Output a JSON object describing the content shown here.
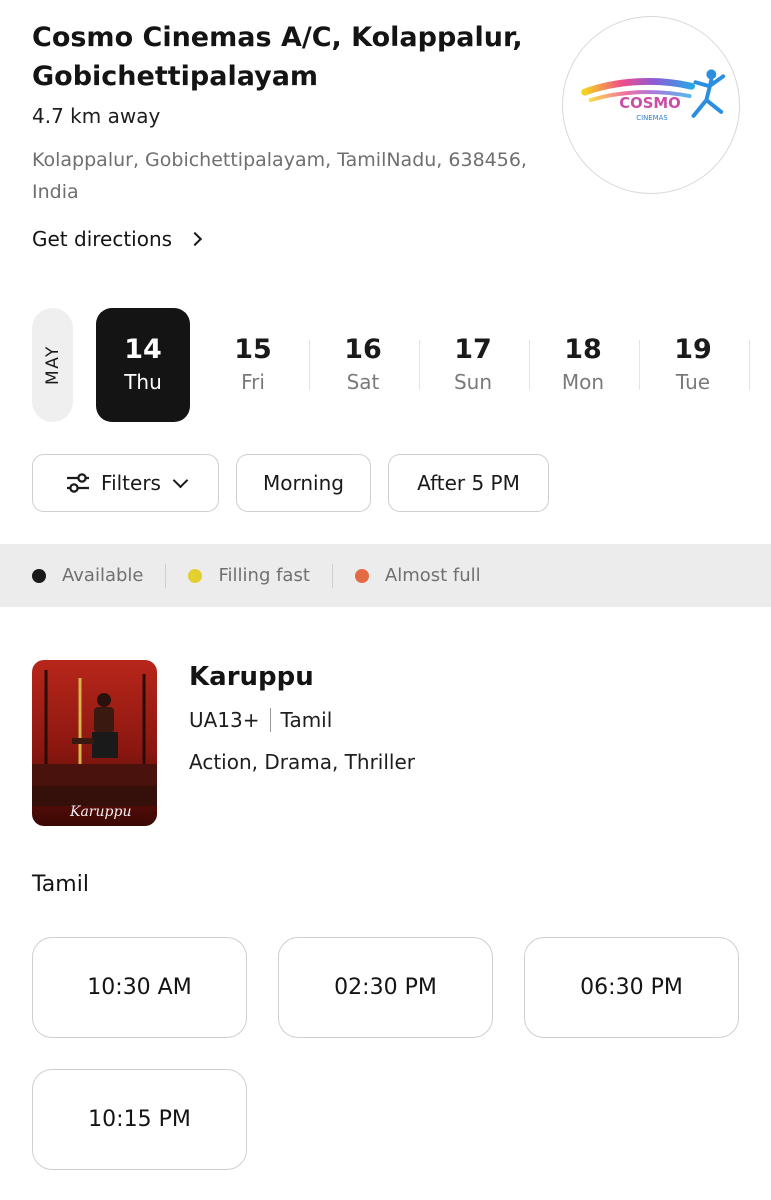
{
  "cinema": {
    "name": "Cosmo Cinemas A/C, Kolappalur, Gobichettipalayam",
    "distance": "4.7 km away",
    "address": "Kolappalur, Gobichettipalayam, TamilNadu, 638456, India",
    "directions_label": "Get directions",
    "logo_text": "COSMO",
    "logo_subtext": "CINEMAS"
  },
  "dates": {
    "month": "MAY",
    "items": [
      {
        "num": "14",
        "day": "Thu",
        "selected": true
      },
      {
        "num": "15",
        "day": "Fri"
      },
      {
        "num": "16",
        "day": "Sat"
      },
      {
        "num": "17",
        "day": "Sun"
      },
      {
        "num": "18",
        "day": "Mon"
      },
      {
        "num": "19",
        "day": "Tue"
      }
    ]
  },
  "filters": {
    "filters_label": "Filters",
    "morning_label": "Morning",
    "after5_label": "After 5 PM"
  },
  "legend": {
    "items": [
      {
        "label": "Available",
        "color": "#1a1a1a"
      },
      {
        "label": "Filling fast",
        "color": "#e3cf2e"
      },
      {
        "label": "Almost full",
        "color": "#e46a43"
      }
    ]
  },
  "movie": {
    "title": "Karuppu",
    "rating": "UA13+",
    "language": "Tamil",
    "genres": "Action, Drama, Thriller",
    "poster_text": "Karuppu"
  },
  "showtimes": {
    "language_heading": "Tamil",
    "times": [
      "10:30 AM",
      "02:30 PM",
      "06:30 PM",
      "10:15 PM"
    ]
  },
  "colors": {
    "selected_date_bg": "#141414",
    "legend_bg": "#ececec",
    "muted_text": "#707070"
  }
}
